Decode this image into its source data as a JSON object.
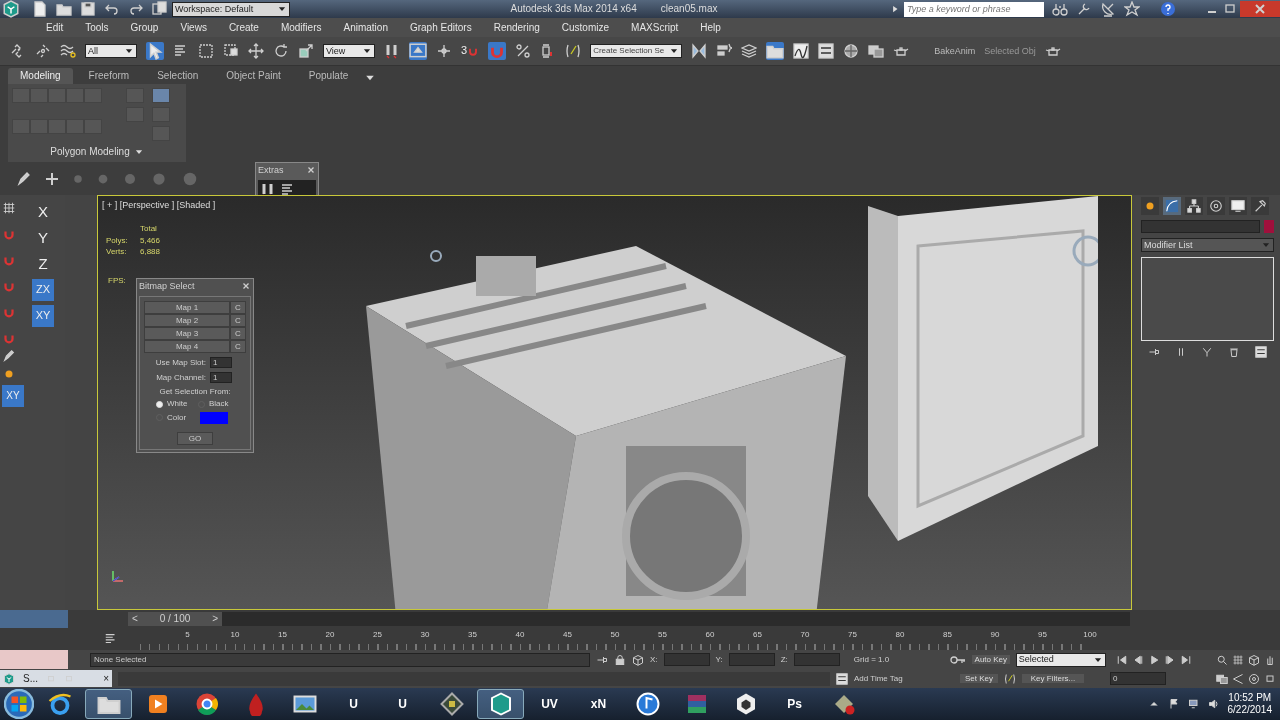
{
  "title_bar": {
    "workspace": "Workspace: Default",
    "app_title": "Autodesk 3ds Max 2014 x64",
    "file_name": "clean05.max",
    "search": {
      "placeholder": "Type a keyword or phrase"
    }
  },
  "menu": [
    "Edit",
    "Tools",
    "Group",
    "Views",
    "Create",
    "Modifiers",
    "Animation",
    "Graph Editors",
    "Rendering",
    "Customize",
    "MAXScript",
    "Help"
  ],
  "main_toolbar": {
    "selection_filter": "All",
    "select_object_on": true,
    "reference_coord": "View",
    "window_crossing_on": true,
    "snap_label": "3",
    "snap_on": true,
    "named_selection": {
      "placeholder": "Create Selection Se"
    },
    "scene_explorer_on": true,
    "bake_label": "BakeAnim",
    "selected_label": "Selected Obj"
  },
  "ribbon": {
    "tabs": [
      {
        "label": "Modeling",
        "selected": true
      },
      {
        "label": "Freeform",
        "selected": false
      },
      {
        "label": "Selection",
        "selected": false
      },
      {
        "label": "Object Paint",
        "selected": false
      },
      {
        "label": "Populate",
        "selected": false
      }
    ],
    "panel_title": "Polygon Modeling"
  },
  "extras": {
    "title": "Extras"
  },
  "axis_constraints": [
    {
      "label": "X",
      "selected": false
    },
    {
      "label": "Y",
      "selected": false
    },
    {
      "label": "Z",
      "selected": false
    },
    {
      "label": "ZX",
      "selected": true
    },
    {
      "label": "XY",
      "selected": true
    }
  ],
  "extra_axis": {
    "label": "XY",
    "selected": true
  },
  "viewport": {
    "label": "[ + ] [Perspective ] [Shaded ]",
    "stats_header": "Total",
    "stats": [
      {
        "label": "Polys:",
        "value": "5,466"
      },
      {
        "label": "Verts:",
        "value": "6,888"
      }
    ],
    "fps_label": "FPS:"
  },
  "bitmap_select": {
    "title": "Bitmap Select",
    "maps": [
      {
        "label": "Map 1",
        "clear": "C"
      },
      {
        "label": "Map 2",
        "clear": "C"
      },
      {
        "label": "Map 3",
        "clear": "C"
      },
      {
        "label": "Map 4",
        "clear": "C"
      }
    ],
    "fields": [
      {
        "label": "Use Map Slot:",
        "value": "1"
      },
      {
        "label": "Map Channel:",
        "value": "1"
      }
    ],
    "heading": "Get Selection From:",
    "options": [
      {
        "label": "White",
        "selected": true
      },
      {
        "label": "Black",
        "selected": false
      },
      {
        "label": "Color",
        "selected": false
      }
    ],
    "color": "#0000ff",
    "go": "GO"
  },
  "command_panel": {
    "tabs": [
      {
        "selected": false
      },
      {
        "selected": true
      },
      {
        "selected": false
      },
      {
        "selected": false
      },
      {
        "selected": false
      },
      {
        "selected": false
      }
    ],
    "color": "#a0103c",
    "modifier_list": "Modifier List"
  },
  "time_slider": {
    "prev": "<",
    "label": "0 / 100",
    "next": ">",
    "level": 0
  },
  "ruler": [
    "5",
    "10",
    "15",
    "20",
    "25",
    "30",
    "35",
    "40",
    "45",
    "50",
    "55",
    "60",
    "65",
    "70",
    "75",
    "80",
    "85",
    "90",
    "95",
    "100"
  ],
  "status": {
    "selection": "None Selected",
    "coords": [
      "X:",
      "Y:",
      "Z:"
    ],
    "grid": "Grid = 1.0",
    "time_tag": "Add Time Tag"
  },
  "animation": {
    "auto_key": "Auto Key",
    "key_mode": "Selected",
    "set_key": "Set Key",
    "key_filters": "Key Filters...",
    "frame": "0"
  },
  "listener": {
    "label": "S...",
    "close": "×"
  },
  "taskbar": {
    "apps": [
      {
        "kind": "ie",
        "selected": false
      },
      {
        "kind": "folder",
        "selected": true
      },
      {
        "kind": "media",
        "selected": false
      },
      {
        "kind": "chrome",
        "selected": false
      },
      {
        "kind": "drop",
        "selected": false
      },
      {
        "kind": "photos",
        "selected": false
      },
      {
        "kind": "letter",
        "label": "U",
        "selected": false
      },
      {
        "kind": "letter",
        "label": "U",
        "selected": false
      },
      {
        "kind": "game",
        "selected": false
      },
      {
        "kind": "max",
        "selected": true
      },
      {
        "kind": "letter",
        "label": "UV",
        "selected": false
      },
      {
        "kind": "letter",
        "label": "xN",
        "selected": false
      },
      {
        "kind": "music",
        "selected": false
      },
      {
        "kind": "archive",
        "selected": false
      },
      {
        "kind": "unity",
        "selected": false
      },
      {
        "kind": "letter",
        "label": "Ps",
        "selected": false
      },
      {
        "kind": "tool",
        "selected": false
      }
    ],
    "clock": {
      "time": "10:52 PM",
      "date": "6/22/2014"
    }
  }
}
